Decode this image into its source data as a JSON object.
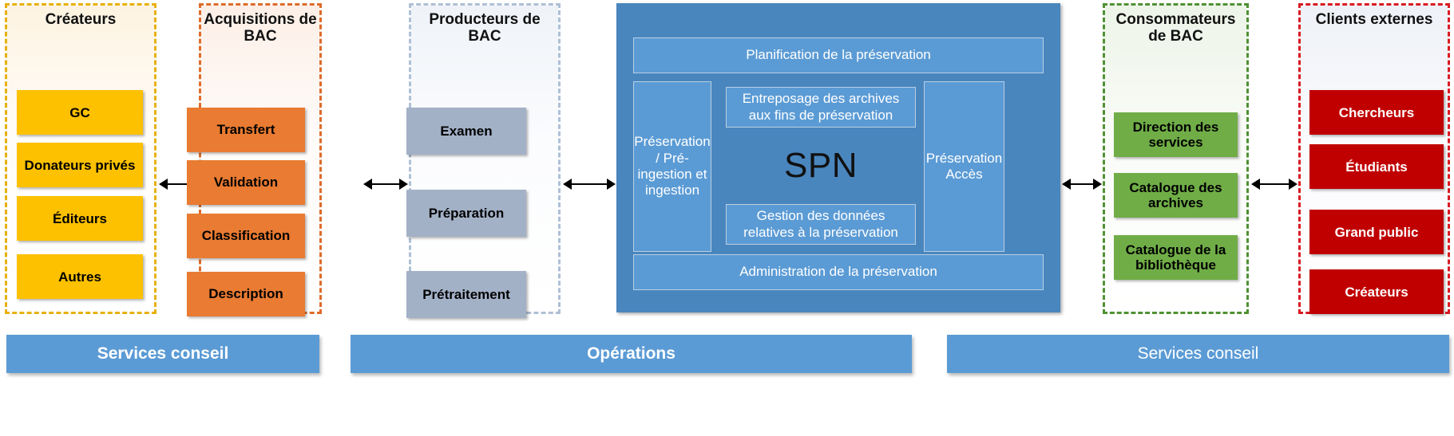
{
  "diagram": {
    "title_text": "",
    "colors": {
      "yellow": "#FDC100",
      "orange": "#E97B32",
      "grey_blue": "#A3B1C7",
      "green": "#70AD47",
      "red": "#C00000",
      "blue_dark": "#4A86BE",
      "blue_light": "#5B9BD5",
      "dash_yellow": "#E8B00D",
      "dash_orange": "#DE6B2A",
      "dash_grey": "#AEC0D6",
      "dash_green": "#4F9133",
      "dash_red": "#D81B23"
    }
  },
  "columns": [
    {
      "id": "createurs",
      "title": "Créateurs",
      "accent": "#FDC100",
      "dash": "#E8B00D",
      "tint": "#FDF3E1",
      "text_color": "#000000",
      "items": [
        "GC",
        "Donateurs privés",
        "Éditeurs",
        "Autres"
      ]
    },
    {
      "id": "acquisitions",
      "title": "Acquisitions de BAC",
      "accent": "#E97B32",
      "dash": "#DE6B2A",
      "tint": "#FDEFE7",
      "text_color": "#000000",
      "items": [
        "Transfert",
        "Validation",
        "Classification",
        "Description"
      ]
    },
    {
      "id": "producteurs",
      "title": "Producteurs de BAC",
      "accent": "#A3B1C7",
      "dash": "#AEC0D6",
      "tint": "#EFF3F8",
      "text_color": "#000000",
      "items": [
        "Examen",
        "Préparation",
        "Prétraitement"
      ]
    },
    {
      "id": "consommateurs",
      "title": "Consommateurs de BAC",
      "accent": "#70AD47",
      "dash": "#4F9133",
      "tint": "#EDF4E8",
      "text_color": "#000000",
      "items": [
        "Direction des services",
        "Catalogue des archives",
        "Catalogue de la bibliothèque"
      ]
    },
    {
      "id": "clients",
      "title": "Clients externes",
      "accent": "#C00000",
      "dash": "#D81B23",
      "tint": "#EEF1F7",
      "text_color": "#000000",
      "items": [
        "Chercheurs",
        "Étudiants",
        "Grand public",
        "Créateurs"
      ]
    }
  ],
  "spn": {
    "top_band": "Planification de la préservation",
    "left_band": "Préservation / Pré-ingestion et ingestion",
    "storage_band": "Entreposage des archives aux fins de préservation",
    "core_label": "SPN",
    "data_band": "Gestion des données relatives à la préservation",
    "right_band": "Préservation Accès",
    "bottom_band": "Administration de la préservation"
  },
  "banners": [
    {
      "id": "services-conseil-left",
      "label": "Services conseil",
      "bold": true
    },
    {
      "id": "operations",
      "label": "Opérations",
      "bold": true
    },
    {
      "id": "services-conseil-right",
      "label": "Services conseil",
      "bold": false
    }
  ],
  "arrows": [
    {
      "id": "arrow-createurs-acquisitions"
    },
    {
      "id": "arrow-acquisitions-producteurs"
    },
    {
      "id": "arrow-producteurs-spn"
    },
    {
      "id": "arrow-spn-consommateurs"
    },
    {
      "id": "arrow-consommateurs-clients"
    }
  ]
}
